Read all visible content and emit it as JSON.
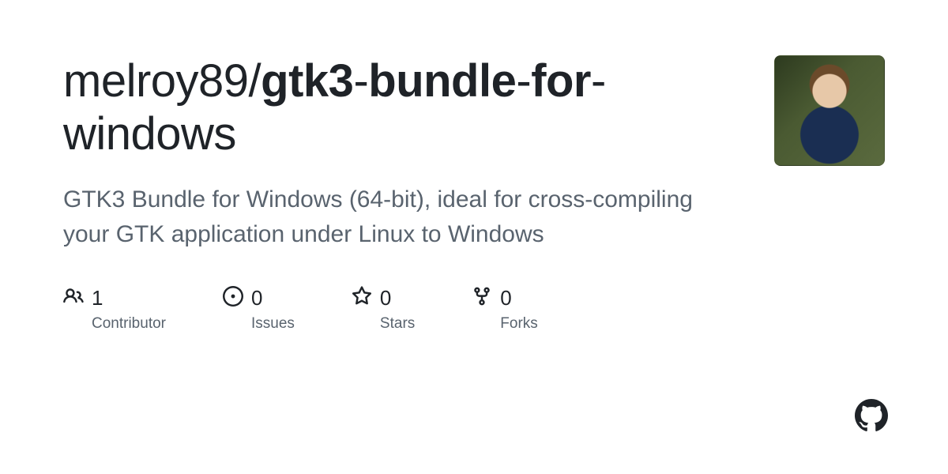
{
  "repo": {
    "owner": "melroy89",
    "separator": "/",
    "name_parts": [
      {
        "text": "gtk3",
        "bold": true
      },
      {
        "text": "-",
        "bold": false
      },
      {
        "text": "bundle",
        "bold": true
      },
      {
        "text": "-",
        "bold": false
      },
      {
        "text": "for",
        "bold": true
      },
      {
        "text": "-",
        "bold": false
      },
      {
        "text": "windows",
        "bold": false
      }
    ],
    "description": "GTK3 Bundle for Windows (64-bit), ideal for cross-compiling your GTK application under Linux to Windows"
  },
  "stats": {
    "contributors": {
      "value": "1",
      "label": "Contributor"
    },
    "issues": {
      "value": "0",
      "label": "Issues"
    },
    "stars": {
      "value": "0",
      "label": "Stars"
    },
    "forks": {
      "value": "0",
      "label": "Forks"
    }
  },
  "icons": {
    "contributors": "people-icon",
    "issues": "issue-opened-icon",
    "stars": "star-icon",
    "forks": "repo-forked-icon",
    "logo": "github-mark-icon"
  }
}
